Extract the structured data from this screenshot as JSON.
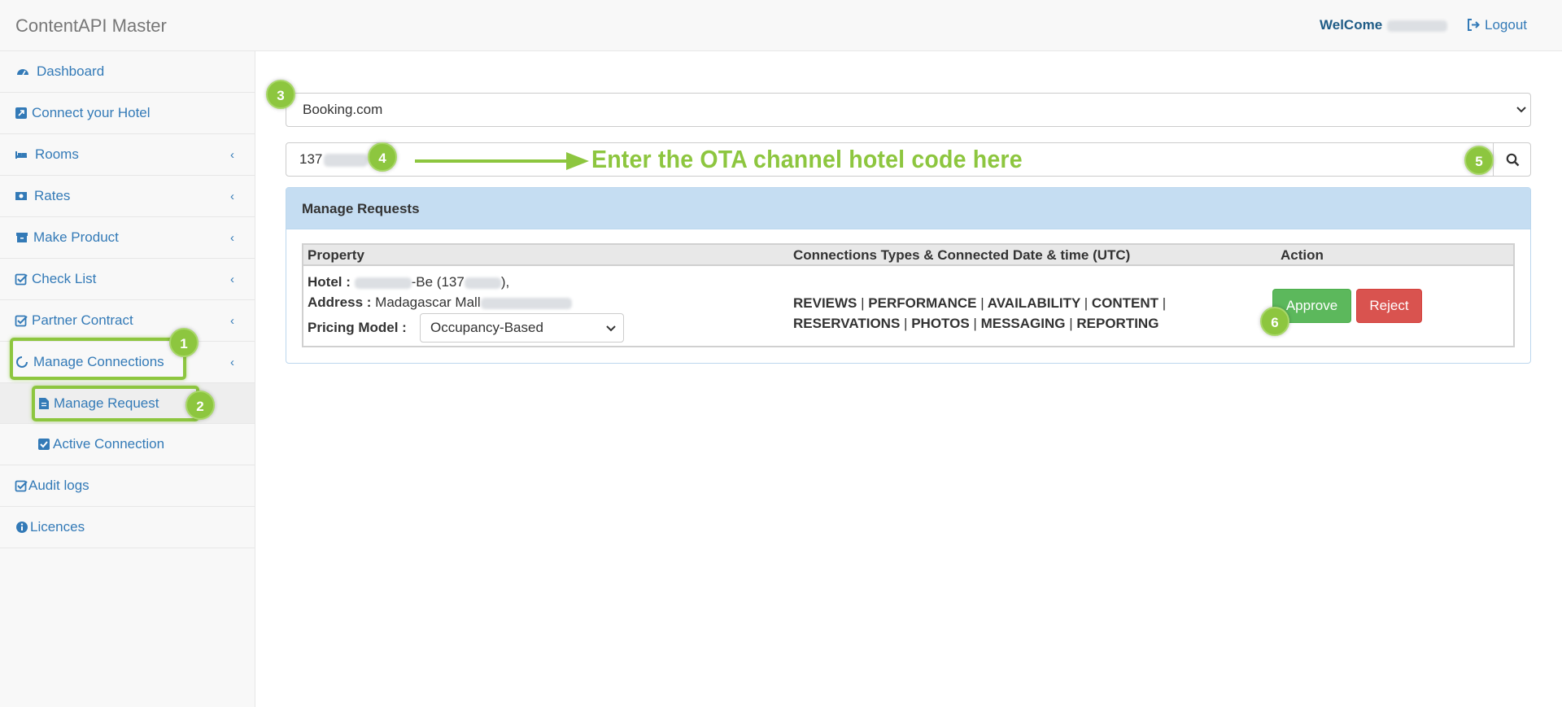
{
  "navbar": {
    "brand": "ContentAPI Master",
    "welcome_label": "WelCome",
    "logout_label": "Logout"
  },
  "sidebar": {
    "items": [
      {
        "label": "Dashboard",
        "icon": "dashboard-icon"
      },
      {
        "label": "Connect your Hotel",
        "icon": "external-link-icon"
      },
      {
        "label": "Rooms",
        "icon": "bed-icon"
      },
      {
        "label": "Rates",
        "icon": "money-icon"
      },
      {
        "label": "Make Product",
        "icon": "archive-icon"
      },
      {
        "label": "Check List",
        "icon": "check-square-icon"
      },
      {
        "label": "Partner Contract",
        "icon": "check-square-icon"
      },
      {
        "label": "Manage Connections",
        "icon": "circle-notch-icon"
      },
      {
        "label": "Manage Request",
        "icon": "file-icon"
      },
      {
        "label": "Active Connection",
        "icon": "checkbox-icon"
      },
      {
        "label": "Audit logs",
        "icon": "check-square-icon"
      },
      {
        "label": "Licences",
        "icon": "info-circle-icon"
      }
    ]
  },
  "main": {
    "ota_select_value": "Booking.com",
    "search_value_prefix": "137",
    "annotation_text": "Enter the OTA channel hotel code here",
    "panel_title": "Manage Requests",
    "table": {
      "headers": [
        "Property",
        "Connections Types & Connected Date & time (UTC)",
        "Action"
      ],
      "row": {
        "hotel_label": "Hotel :",
        "hotel_value_mid": "-Be (137",
        "hotel_value_end": "),",
        "address_label": "Address :",
        "address_value": "Madagascar Mall",
        "pricing_label": "Pricing Model :",
        "pricing_value": "Occupancy-Based",
        "types_line1": [
          "REVIEWS",
          "PERFORMANCE",
          "AVAILABILITY",
          "CONTENT"
        ],
        "types_line2": [
          "RESERVATIONS",
          "PHOTOS",
          "MESSAGING",
          "REPORTING"
        ],
        "separator": "|"
      }
    },
    "approve_label": "Approve",
    "reject_label": "Reject"
  },
  "annotations": {
    "badges": [
      "1",
      "2",
      "3",
      "4",
      "5",
      "6"
    ],
    "color": "#8dc63f"
  },
  "colors": {
    "link": "#337ab7",
    "panel_header": "#c5ddf2",
    "approve": "#5cb85c",
    "reject": "#d9534f"
  }
}
